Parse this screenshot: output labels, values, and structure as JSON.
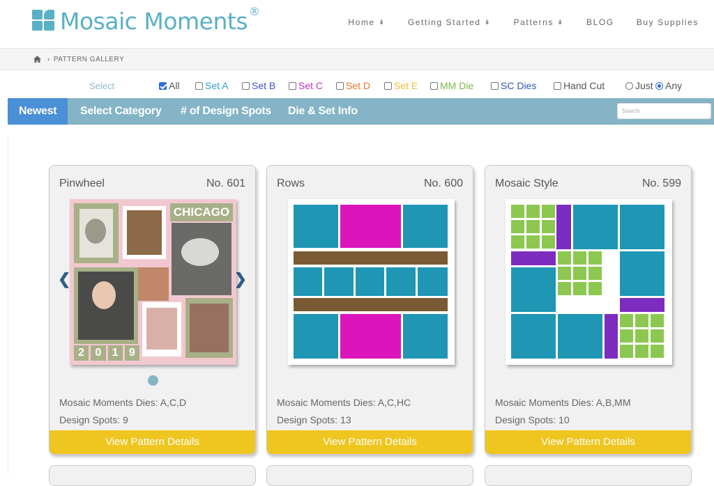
{
  "brand": {
    "name": "Mosaic Moments",
    "reg": "®",
    "color": "#5ab0c4"
  },
  "nav": [
    {
      "label": "Home",
      "has_dropdown": true
    },
    {
      "label": "Getting Started",
      "has_dropdown": true
    },
    {
      "label": "Patterns",
      "has_dropdown": true
    },
    {
      "label": "BLOG",
      "has_dropdown": false
    },
    {
      "label": "Buy Supplies",
      "has_dropdown": false
    }
  ],
  "breadcrumb": {
    "home_icon": "home-icon",
    "current": "PATTERN GALLERY"
  },
  "filters": {
    "label": "Select",
    "options": [
      {
        "label": "All",
        "checked": true,
        "color": "#555555"
      },
      {
        "label": "Set A",
        "checked": false,
        "color": "#2f9fd6"
      },
      {
        "label": "Set B",
        "checked": false,
        "color": "#3d4fd6"
      },
      {
        "label": "Set C",
        "checked": false,
        "color": "#c030c0"
      },
      {
        "label": "Set D",
        "checked": false,
        "color": "#f07028"
      },
      {
        "label": "Set E",
        "checked": false,
        "color": "#f0c030"
      },
      {
        "label": "MM Die",
        "checked": false,
        "color": "#7ab84a"
      },
      {
        "label": "SC Dies",
        "checked": false,
        "color": "#2b58b8"
      },
      {
        "label": "Hand Cut",
        "checked": false,
        "color": "#555555"
      }
    ],
    "match": [
      {
        "label": "Just",
        "checked": false
      },
      {
        "label": "Any",
        "checked": true
      }
    ]
  },
  "tabs": [
    {
      "label": "Newest",
      "active": true
    },
    {
      "label": "Select Category",
      "active": false
    },
    {
      "label": "# of Design Spots",
      "active": false
    },
    {
      "label": "Die & Set Info",
      "active": false
    }
  ],
  "search": {
    "placeholder": "Search"
  },
  "cards": [
    {
      "title": "Pinwheel",
      "number": "No. 601",
      "dies": "Mosaic Moments Dies: A,C,D",
      "spots": "Design Spots: 9",
      "button": "View Pattern Details",
      "photo_text": "CHICAGO",
      "photo_year": [
        "2",
        "0",
        "1",
        "9"
      ]
    },
    {
      "title": "Rows",
      "number": "No. 600",
      "dies": "Mosaic Moments Dies: A,C,HC",
      "spots": "Design Spots: 13",
      "button": "View Pattern Details"
    },
    {
      "title": "Mosaic Style",
      "number": "No. 599",
      "dies": "Mosaic Moments Dies: A,B,MM",
      "spots": "Design Spots: 10",
      "button": "View Pattern Details"
    }
  ],
  "colors": {
    "teal": "#1f96b4",
    "magenta": "#dc14bc",
    "brown": "#7a5a34",
    "green": "#8cc850",
    "purple": "#7d2cc0",
    "button": "#efc51f",
    "tabbar": "#84b4c6",
    "tab_active": "#4b8fd6"
  }
}
